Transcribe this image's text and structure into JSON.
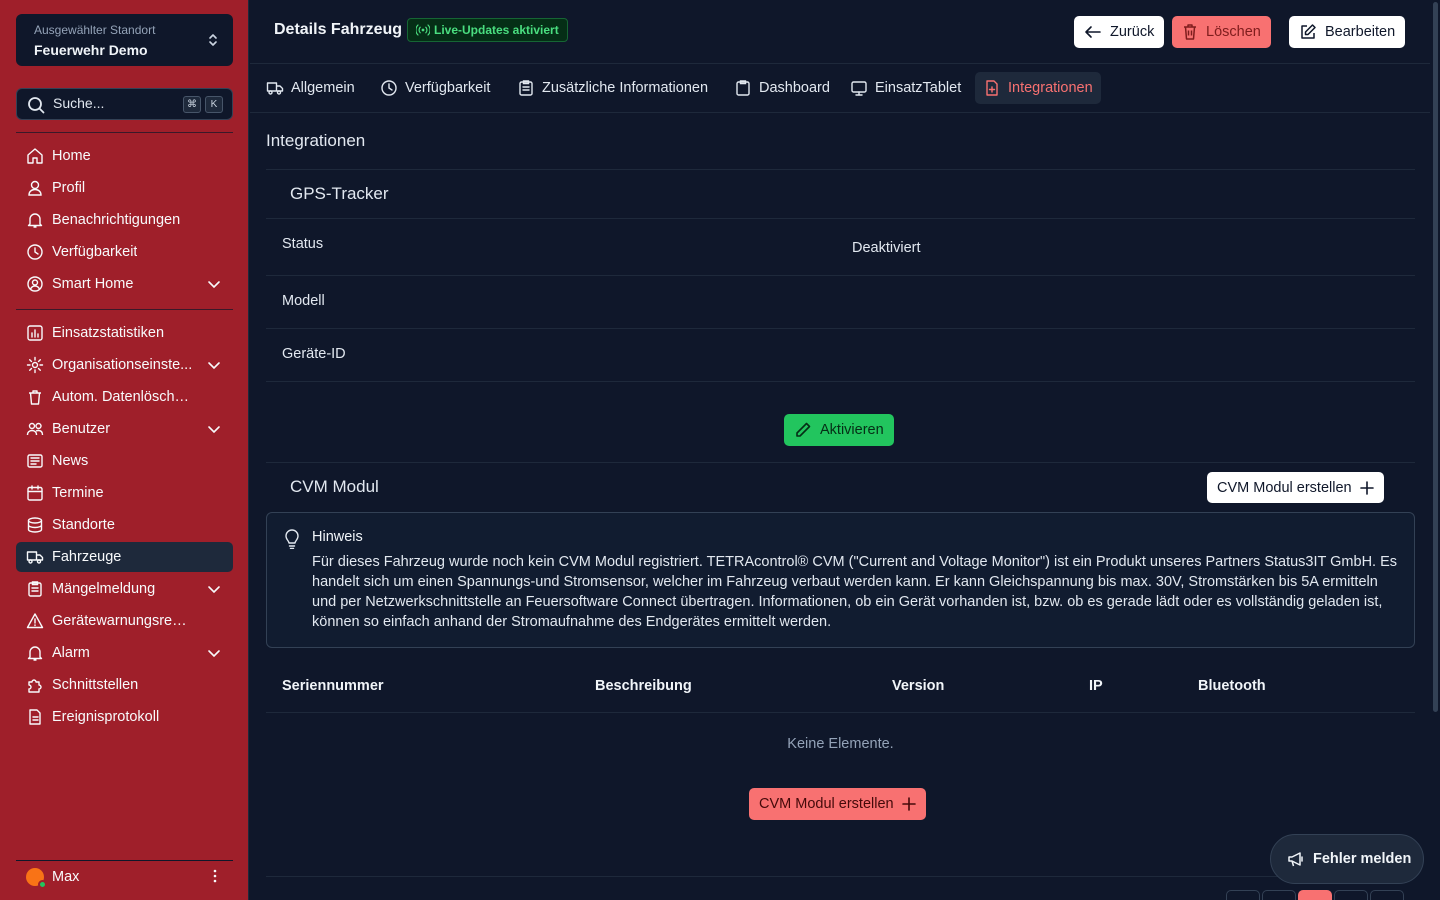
{
  "sidebar": {
    "location_label": "Ausgewählter Standort",
    "location_value": "Feuerwehr Demo",
    "search_placeholder": "Suche...",
    "kbd1": "⌘",
    "kbd2": "K",
    "items": [
      {
        "label": "Home"
      },
      {
        "label": "Profil"
      },
      {
        "label": "Benachrichtigungen"
      },
      {
        "label": "Verfügbarkeit"
      },
      {
        "label": "Smart Home"
      },
      {
        "label": "Einsatzstatistiken"
      },
      {
        "label": "Organisationseinste..."
      },
      {
        "label": "Autom. Datenlöschung"
      },
      {
        "label": "Benutzer"
      },
      {
        "label": "News"
      },
      {
        "label": "Termine"
      },
      {
        "label": "Standorte"
      },
      {
        "label": "Fahrzeuge"
      },
      {
        "label": "Mängelmeldung"
      },
      {
        "label": "Gerätewarnungsregeln"
      },
      {
        "label": "Alarm"
      },
      {
        "label": "Schnittstellen"
      },
      {
        "label": "Ereignisprotokoll"
      }
    ],
    "user_name": "Max"
  },
  "header": {
    "title": "Details Fahrzeug",
    "live_badge": "Live-Updates aktiviert",
    "back_label": "Zurück",
    "delete_label": "Löschen",
    "edit_label": "Bearbeiten"
  },
  "tabs": [
    {
      "label": "Allgemein"
    },
    {
      "label": "Verfügbarkeit"
    },
    {
      "label": "Zusätzliche Informationen"
    },
    {
      "label": "Dashboard"
    },
    {
      "label": "EinsatzTablet"
    },
    {
      "label": "Integrationen"
    }
  ],
  "content": {
    "section_title": "Integrationen",
    "gps": {
      "title": "GPS-Tracker",
      "status_label": "Status",
      "status_value": "Deaktiviert",
      "model_label": "Modell",
      "device_id_label": "Geräte-ID",
      "activate_label": "Aktivieren"
    },
    "cvm": {
      "title": "CVM Modul",
      "create_label": "CVM Modul erstellen",
      "hint_title": "Hinweis",
      "hint_text": "Für dieses Fahrzeug wurde noch kein CVM Modul registriert. TETRAcontrol® CVM (\"Current and Voltage Monitor\") ist ein Produkt unseres Partners Status3IT GmbH. Es handelt sich um einen Spannungs-und Stromsensor, welcher im Fahrzeug verbaut werden kann. Er kann Gleichspannung bis max. 30V, Stromstärken bis 5A ermitteln und per Netzwerkschnittstelle an Feuersoftware Connect übertragen. Informationen, ob ein Gerät vorhanden ist, bzw. ob es gerade lädt oder es vollständig geladen ist, können so einfach anhand der Stromaufnahme des Endgerätes ermittelt werden.",
      "columns": [
        "Seriennummer",
        "Beschreibung",
        "Version",
        "IP",
        "Bluetooth"
      ],
      "empty_text": "Keine Elemente.",
      "create_label_bottom": "CVM Modul erstellen"
    }
  },
  "report_label": "Fehler melden",
  "colors": {
    "sidebar_bg": "#9f1f2a",
    "page_bg": "#0f172a",
    "accent_red": "#f87171",
    "accent_green": "#22c55e"
  }
}
